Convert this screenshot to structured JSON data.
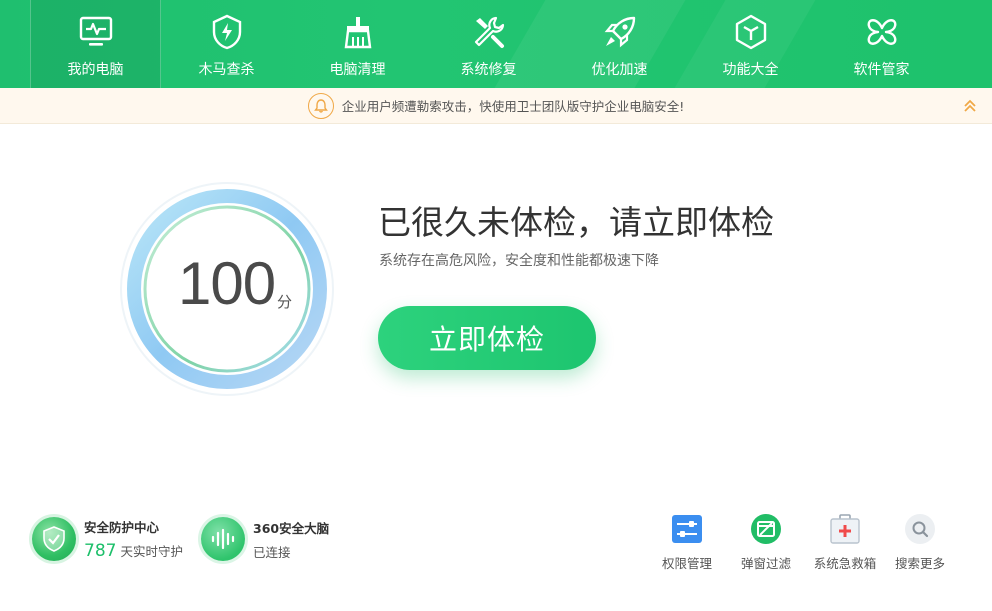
{
  "nav": {
    "items": [
      {
        "label": "我的电脑",
        "icon": "monitor-icon",
        "active": true
      },
      {
        "label": "木马查杀",
        "icon": "shield-bolt-icon"
      },
      {
        "label": "电脑清理",
        "icon": "broom-icon"
      },
      {
        "label": "系统修复",
        "icon": "wrench-icon"
      },
      {
        "label": "优化加速",
        "icon": "rocket-icon"
      },
      {
        "label": "功能大全",
        "icon": "cube-icon"
      },
      {
        "label": "软件管家",
        "icon": "clover-icon"
      }
    ]
  },
  "notice": {
    "text": "企业用户频遭勒索攻击，快使用卫士团队版守护企业电脑安全!",
    "icon": "bell-icon",
    "collapse_icon": "double-chevron-up-icon"
  },
  "score": {
    "value": "100",
    "unit": "分"
  },
  "headline": {
    "title": "已很久未体检，请立即体检",
    "subtitle": "系统存在高危风险，安全度和性能都极速下降"
  },
  "scan_button": {
    "label": "立即体检"
  },
  "status": {
    "protection": {
      "title": "安全防护中心",
      "count": "787",
      "suffix": "天实时守护",
      "icon": "shield-check-icon"
    },
    "brain": {
      "title": "360安全大脑",
      "sub": "已连接",
      "icon": "waveform-icon"
    }
  },
  "tools": [
    {
      "label": "权限管理",
      "icon": "sliders-icon"
    },
    {
      "label": "弹窗过滤",
      "icon": "popup-block-icon"
    },
    {
      "label": "系统急救箱",
      "icon": "first-aid-icon"
    },
    {
      "label": "搜索更多",
      "icon": "search-icon"
    }
  ],
  "colors": {
    "brand_green": "#1ec26c",
    "notice_bg": "#fff8ee",
    "ring_blue": "#8cc6f2",
    "ring_green": "#9be2b8"
  }
}
